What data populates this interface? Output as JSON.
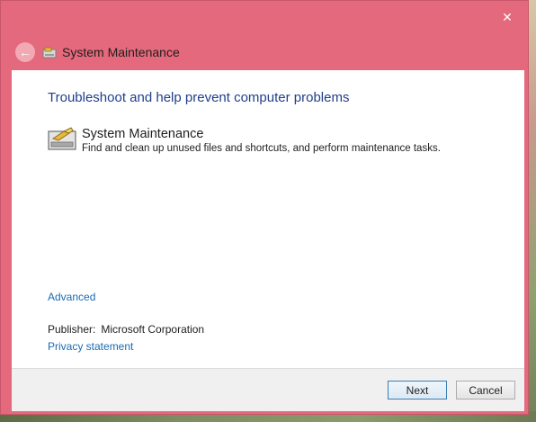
{
  "window": {
    "title": "System Maintenance",
    "close_glyph": "✕",
    "back_glyph": "←",
    "icons": [
      "back-arrow-icon",
      "maintenance-icon",
      "close-icon"
    ]
  },
  "main": {
    "heading": "Troubleshoot and help prevent computer problems",
    "item": {
      "title": "System Maintenance",
      "description": "Find and clean up unused files and shortcuts, and perform maintenance tasks."
    },
    "advanced_link": "Advanced",
    "publisher_label": "Publisher:",
    "publisher_value": "Microsoft Corporation",
    "privacy_link": "Privacy statement"
  },
  "footer": {
    "next_label": "Next",
    "cancel_label": "Cancel"
  },
  "colors": {
    "frame": "#e5697c",
    "heading": "#1e3f8a",
    "link": "#1a6bb3"
  }
}
